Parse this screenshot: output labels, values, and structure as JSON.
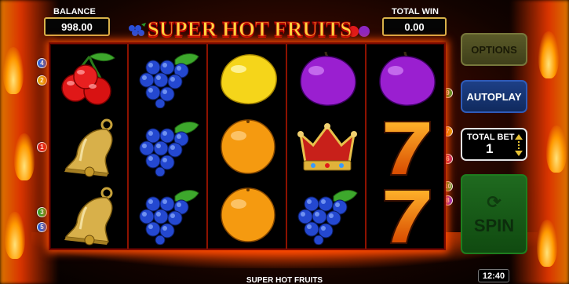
{
  "header": {
    "balance_label": "BALANCE",
    "balance_value": "998.00",
    "total_win_label": "TOTAL WIN",
    "total_win_value": "0.00",
    "game_title": "SUPER HOT FRUITS"
  },
  "reels": [
    [
      "cherry",
      "bell",
      "bell"
    ],
    [
      "grapes",
      "grapes",
      "grapes"
    ],
    [
      "lemon",
      "orange",
      "orange"
    ],
    [
      "plum",
      "crown",
      "grapes"
    ],
    [
      "plum",
      "seven",
      "seven"
    ]
  ],
  "paylines": {
    "left": [
      {
        "num": "4",
        "color": "#2a62d8"
      },
      {
        "num": "2",
        "color": "#e3a60a"
      },
      {
        "num": "1",
        "color": "#d8201a"
      },
      {
        "num": "3",
        "color": "#36a329"
      },
      {
        "num": "5",
        "color": "#2a62d8"
      }
    ],
    "right": [
      {
        "num": "9",
        "color": "#36a329"
      },
      {
        "num": "7",
        "color": "#e3a60a"
      },
      {
        "num": "6",
        "color": "#c2256f"
      },
      {
        "num": "10",
        "color": "#36a329"
      },
      {
        "num": "8",
        "color": "#8a2ad8"
      }
    ]
  },
  "controls": {
    "options_label": "OPTIONS",
    "autoplay_label": "AUTOPLAY",
    "total_bet_label": "TOTAL BET",
    "total_bet_value": "1",
    "spin_label": "SPIN"
  },
  "footer": {
    "title": "SUPER HOT FRUITS",
    "clock": "12:40"
  }
}
